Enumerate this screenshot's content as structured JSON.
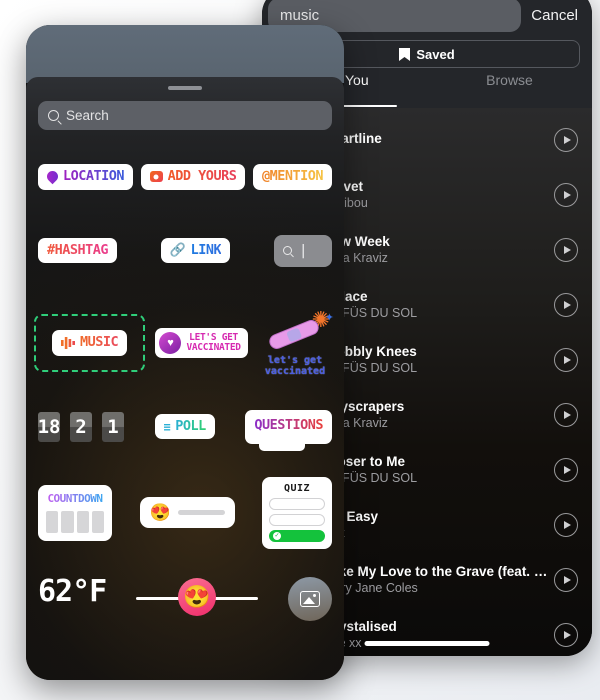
{
  "music_panel": {
    "search_value": "music",
    "cancel_label": "Cancel",
    "saved_label": "Saved",
    "saved_icon": "bookmark-icon",
    "tabs": [
      {
        "label": "For You",
        "active": true
      },
      {
        "label": "Browse",
        "active": false
      }
    ],
    "tracks": [
      {
        "title": "Heartline",
        "artist": ""
      },
      {
        "title": "Velvet",
        "artist": "Caribou"
      },
      {
        "title": "Low Week",
        "artist": "Nina Kraviz"
      },
      {
        "title": "Solace",
        "artist": "RÜFÜS DU SOL"
      },
      {
        "title": "Wobbly Knees",
        "artist": "RÜFÜS DU SOL"
      },
      {
        "title": "Skyscrapers",
        "artist": "Nina Kraviz"
      },
      {
        "title": "Closer to Me",
        "artist": "RÜFÜS DU SOL"
      },
      {
        "title": "Go Easy",
        "artist": "Fox"
      },
      {
        "title": "Take My Love to the Grave (feat. Claudia K...",
        "artist": "Mary Jane Coles"
      },
      {
        "title": "Crystalised",
        "artist": "The xx"
      }
    ],
    "play_icon": "play-icon"
  },
  "sticker_tray": {
    "search_placeholder": "Search",
    "search_icon": "search-icon",
    "grabber": "drag-handle",
    "rows": [
      {
        "items": [
          {
            "kind": "pill",
            "label": "LOCATION",
            "icon": "location-pin-icon"
          },
          {
            "kind": "pill",
            "label": "ADD YOURS",
            "icon": "camera-icon"
          },
          {
            "kind": "pill",
            "label": "@MENTION",
            "icon": ""
          }
        ]
      },
      {
        "items": [
          {
            "kind": "pill",
            "label": "#HASHTAG",
            "icon": ""
          },
          {
            "kind": "pill",
            "label": "LINK",
            "icon": "link-icon"
          },
          {
            "kind": "gif",
            "label": "",
            "icon": "search-icon"
          }
        ]
      },
      {
        "items": [
          {
            "kind": "pill",
            "label": "MUSIC",
            "icon": "music-bars-icon",
            "selected": true
          },
          {
            "kind": "vaccine",
            "label": "LET'S GET VACCINATED",
            "line1": "LET'S GET",
            "line2": "VACCINATED"
          },
          {
            "kind": "bandaid",
            "line1": "let's get",
            "line2": "vaccinated"
          }
        ]
      },
      {
        "items": [
          {
            "kind": "flip",
            "digits": [
              "18",
              "2",
              "1"
            ]
          },
          {
            "kind": "pill",
            "label": "POLL",
            "icon": "poll-icon"
          },
          {
            "kind": "questions",
            "label": "QUESTIONS"
          }
        ]
      },
      {
        "items": [
          {
            "kind": "countdown",
            "label": "COUNTDOWN"
          },
          {
            "kind": "slider",
            "emoji": "😍"
          },
          {
            "kind": "quiz",
            "label": "QUIZ"
          }
        ]
      },
      {
        "items": [
          {
            "kind": "temp",
            "label": "62°F"
          },
          {
            "kind": "bigslider",
            "emoji": "😍"
          },
          {
            "kind": "photo",
            "icon": "image-icon"
          }
        ]
      }
    ]
  },
  "colors": {
    "selection_green": "#2fce7a",
    "tray_bg": "#141210",
    "panel_bg": "#0e0e0e",
    "quiz_correct": "#14c23c"
  }
}
